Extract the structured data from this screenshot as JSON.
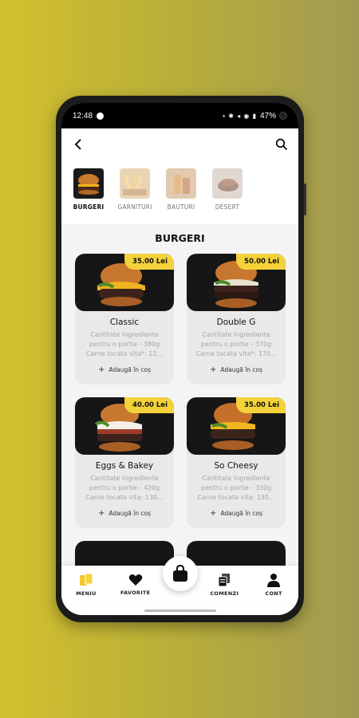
{
  "status": {
    "time": "12:48",
    "battery": "47%"
  },
  "categories": [
    {
      "label": "BURGERI",
      "active": true
    },
    {
      "label": "GARNITURI",
      "active": false
    },
    {
      "label": "BAUTURI",
      "active": false
    },
    {
      "label": "DESERT",
      "active": false
    }
  ],
  "section_title": "BURGERI",
  "products": [
    {
      "name": "Classic",
      "price": "35.00 Lei",
      "desc": "Cantitate ingrediente pentru o portie - 380g Carne tocata vita*: 12...",
      "add": "Adaugă în coș"
    },
    {
      "name": "Double G",
      "price": "50.00 Lei",
      "desc": "Cantitate ingrediente pentru o portie - 370g Carne tocata vita*: 170...",
      "add": "Adaugă în coș"
    },
    {
      "name": "Eggs & Bakey",
      "price": "40.00 Lei",
      "desc": "Cantitate ingrediente pentru o portie - 420g Carne tocata vita: 130...",
      "add": "Adaugă în coș"
    },
    {
      "name": "So Cheesy",
      "price": "35.00 Lei",
      "desc": "Cantitate ingrediente pentru o portie - 330g Carne tocata vita: 130...",
      "add": "Adaugă în coș"
    }
  ],
  "nav": {
    "menu": "MENIU",
    "favorites": "FAVORITE",
    "orders": "COMENZI",
    "account": "CONT"
  },
  "colors": {
    "accent": "#f3d23a"
  }
}
